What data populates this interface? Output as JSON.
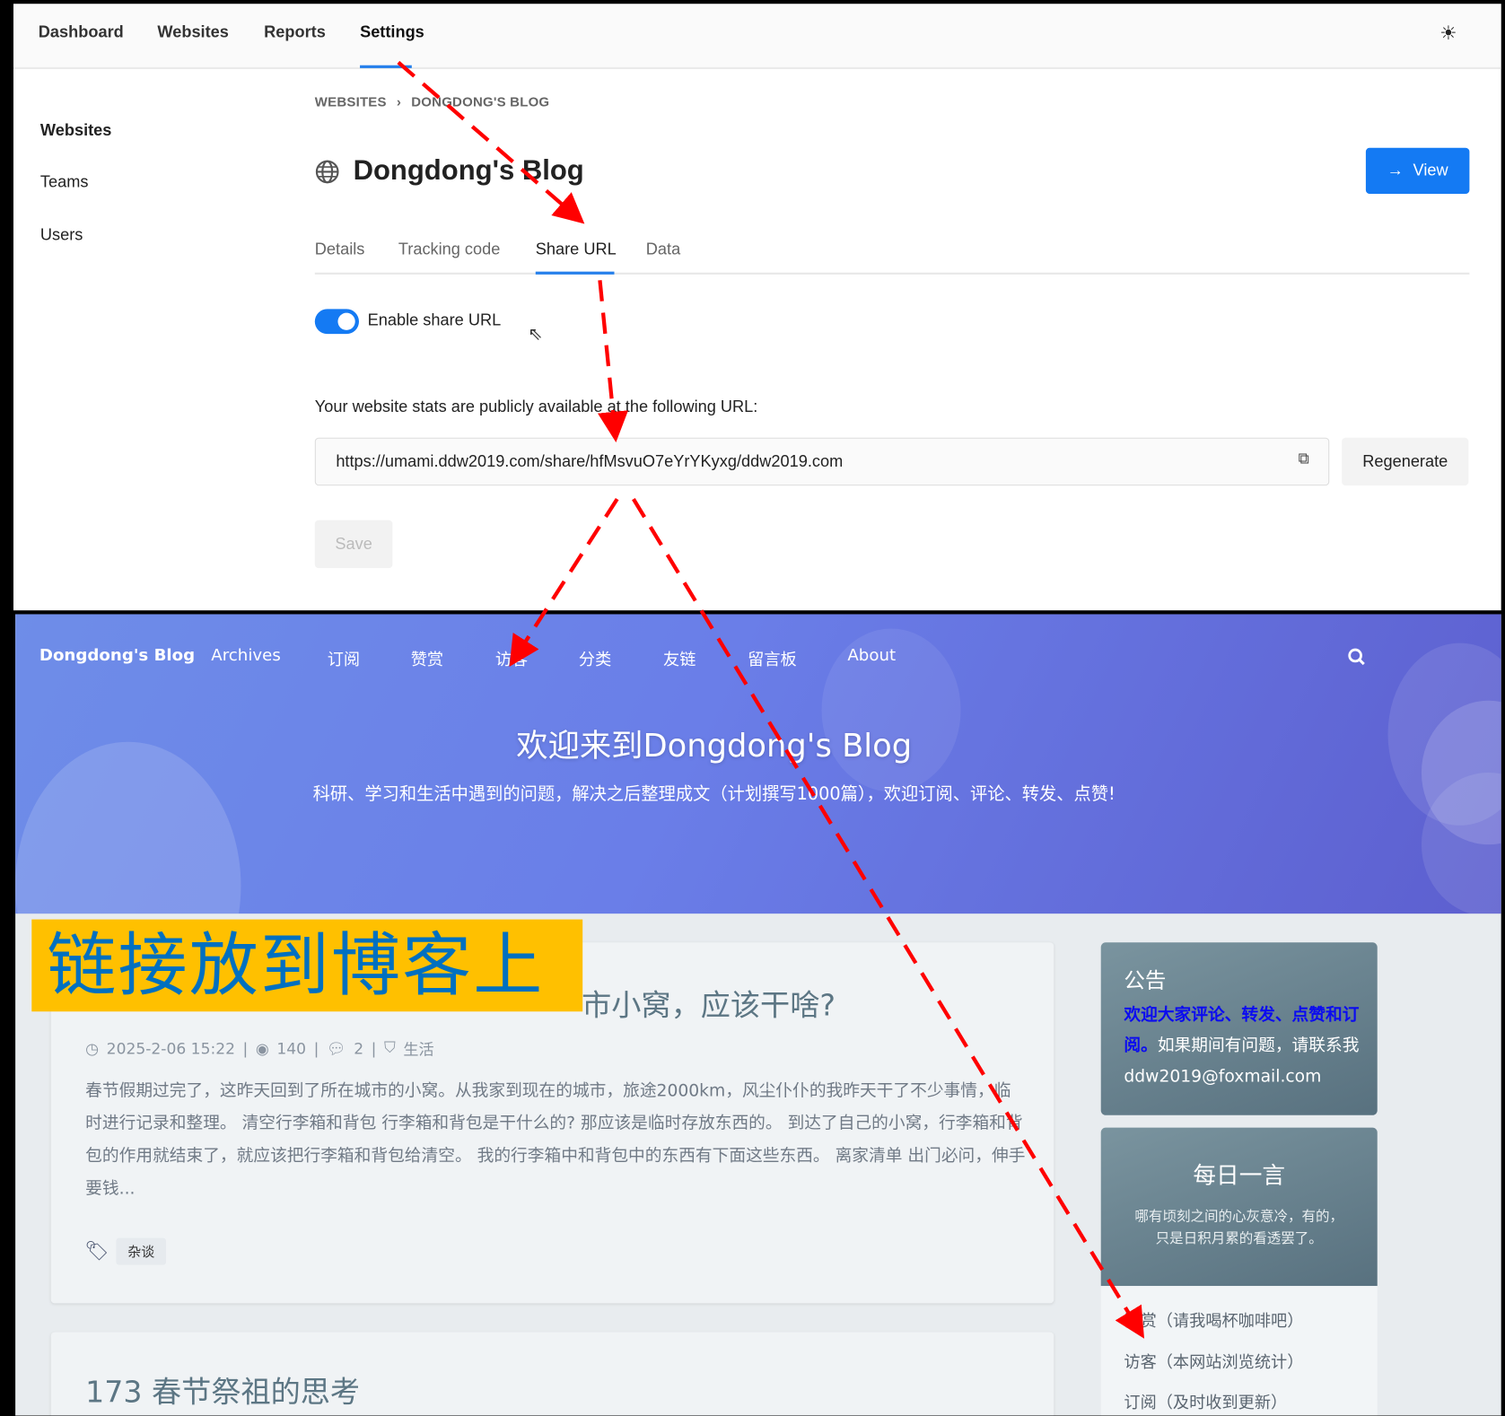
{
  "umami": {
    "nav": [
      "Dashboard",
      "Websites",
      "Reports",
      "Settings"
    ],
    "active_nav": "Settings",
    "theme_icon": "sun-icon",
    "sidebar": [
      "Websites",
      "Teams",
      "Users"
    ],
    "breadcrumb": [
      "WEBSITES",
      "DONGDONG'S BLOG"
    ],
    "title": "Dongdong's Blog",
    "view_button": "View",
    "tabs": [
      "Details",
      "Tracking code",
      "Share URL",
      "Data"
    ],
    "active_tab": "Share URL",
    "toggle_label": "Enable share URL",
    "toggle_on": true,
    "public_text": "Your website stats are publicly available at the following URL:",
    "share_url": "https://umami.ddw2019.com/share/hfMsvuO7eYrYKyxg/ddw2019.com",
    "regenerate": "Regenerate",
    "save": "Save",
    "accent": "#147af3"
  },
  "blog": {
    "brand": "Dongdong's Blog",
    "nav": [
      "Archives",
      "订阅",
      "赞赏",
      "访客",
      "分类",
      "友链",
      "留言板",
      "About"
    ],
    "hero_title": "欢迎来到Dongdong's Blog",
    "hero_subtitle": "科研、学习和生活中遇到的问题，解决之后整理成文（计划撰写1000篇），欢迎订阅、评论、转发、点赞!",
    "post1": {
      "title_visible": "市小窝，应该干啥?",
      "date": "2025-2-06 15:22",
      "views": "140",
      "comments": "2",
      "category": "生活",
      "excerpt": "春节假期过完了，这昨天回到了所在城市的小窝。从我家到现在的城市，旅途2000km，风尘仆仆的我昨天干了不少事情，临时进行记录和整理。 清空行李箱和背包 行李箱和背包是干什么的? 那应该是临时存放东西的。 到达了自己的小窝，行李箱和背包的作用就结束了，就应该把行李箱和背包给清空。 我的行李箱中和背包中的东西有下面这些东西。 离家清单 出门必问，伸手要钱...",
      "tag": "杂谈"
    },
    "post2_title": "173 春节祭祖的思考",
    "notice": {
      "title": "公告",
      "highlight": "欢迎大家评论、转发、点赞和订阅。",
      "text": "如果期间有问题，请联系我 ddw2019@foxmail.com"
    },
    "daily": {
      "title": "每日一言",
      "quote": "哪有顷刻之间的心灰意冷，有的，只是日积月累的看透罢了。"
    },
    "links": [
      "赞赏（请我喝杯咖啡吧）",
      "访客（本网站浏览统计）",
      "订阅（及时收到更新）"
    ]
  },
  "annotation": {
    "label": "链接放到博客上",
    "label_bg": "#ffc000",
    "label_color": "#0070c0",
    "arrow_color": "#ff0000"
  }
}
